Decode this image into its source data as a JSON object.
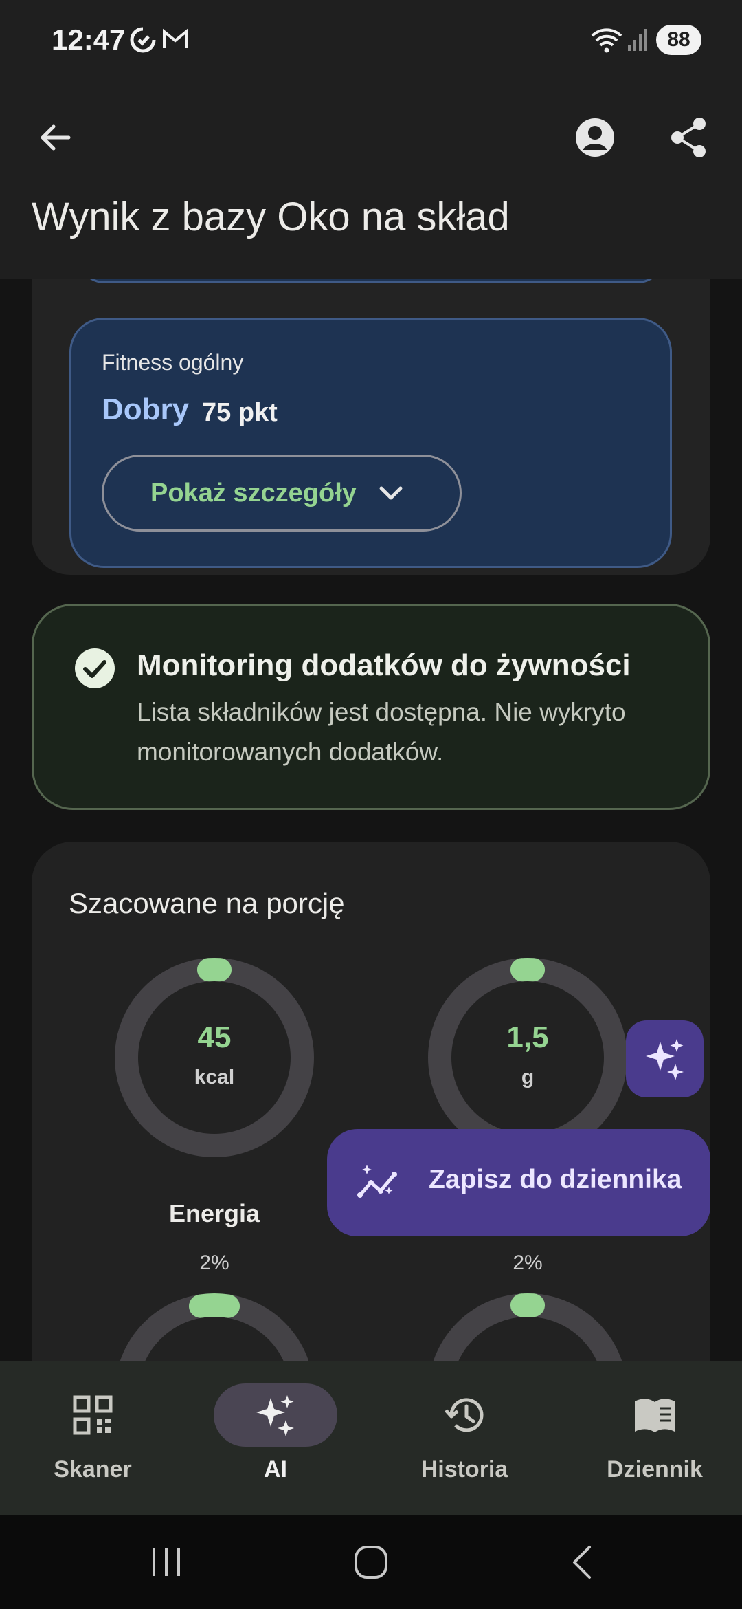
{
  "status_bar": {
    "time": "12:47",
    "battery": "88"
  },
  "app_bar": {
    "title": "Wynik z bazy Oko na skład"
  },
  "fitness_card": {
    "title": "Fitness ogólny",
    "grade": "Dobry",
    "points": "75 pkt",
    "details_label": "Pokaż szczegóły"
  },
  "monitor_card": {
    "title": "Monitoring dodatków do żywności",
    "text": "Lista składników jest dostępna. Nie wykryto monitorowanych dodatków."
  },
  "portion_card": {
    "title": "Szacowane na porcję",
    "gauges": [
      {
        "value": "45",
        "unit": "kcal",
        "label": "Energia",
        "percent": "2%",
        "fill": 0.02
      },
      {
        "value": "1,5",
        "unit": "g",
        "label": "",
        "percent": "2%",
        "fill": 0.02
      },
      {
        "fill": 0.05
      },
      {
        "fill": 0.02
      }
    ]
  },
  "fab": {
    "journal_label": "Zapisz do dziennika"
  },
  "bottom_nav": {
    "items": [
      {
        "label": "Skaner",
        "icon": "qr-scan-icon"
      },
      {
        "label": "AI",
        "icon": "sparkles-icon"
      },
      {
        "label": "Historia",
        "icon": "history-icon"
      },
      {
        "label": "Dziennik",
        "icon": "book-icon"
      }
    ],
    "active_index": 1
  },
  "colors": {
    "accent_green": "#95d491",
    "accent_blue": "#a8c7fa",
    "fab_purple": "#4a3b8d"
  }
}
